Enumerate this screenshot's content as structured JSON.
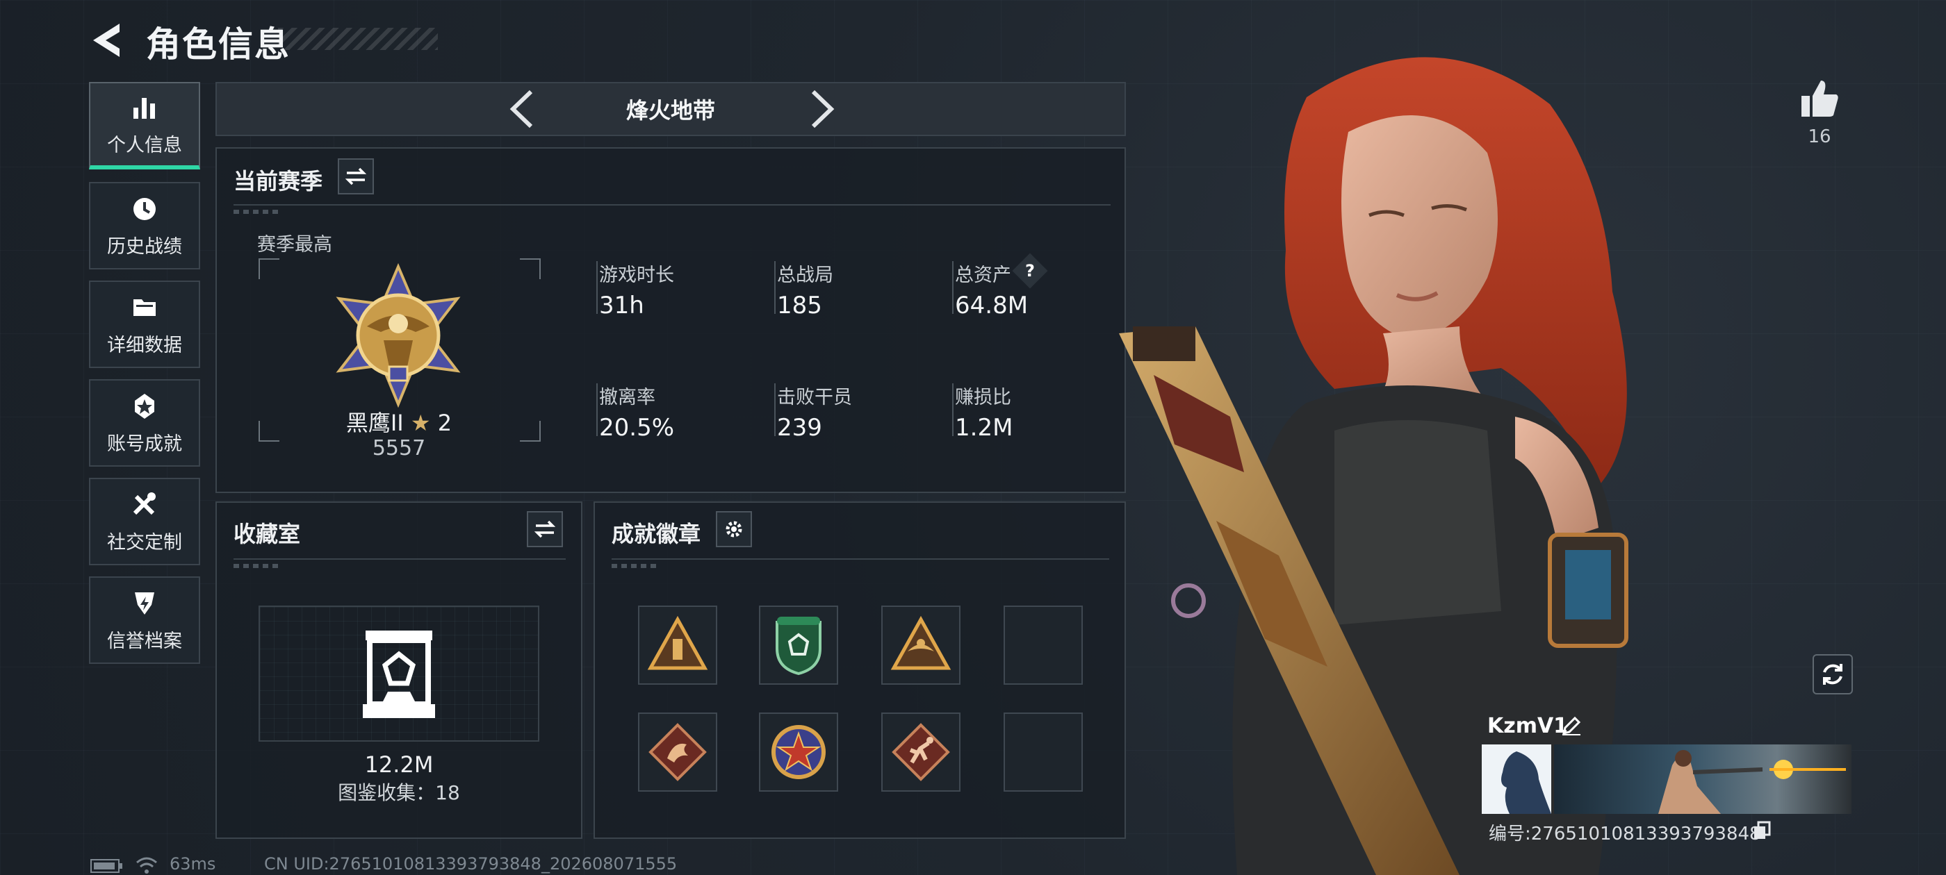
{
  "header": {
    "title": "角色信息"
  },
  "sidebar": {
    "items": [
      {
        "label": "个人信息",
        "icon": "bar-chart-icon",
        "active": true
      },
      {
        "label": "历史战绩",
        "icon": "history-clock-icon"
      },
      {
        "label": "详细数据",
        "icon": "folder-icon"
      },
      {
        "label": "账号成就",
        "icon": "achievement-icon"
      },
      {
        "label": "社交定制",
        "icon": "tools-icon"
      },
      {
        "label": "信誉档案",
        "icon": "credit-shield-icon"
      }
    ]
  },
  "mode_selector": {
    "label": "烽火地带"
  },
  "season": {
    "title": "当前赛季",
    "best_label": "赛季最高",
    "rank_name": "黑鹰II",
    "rank_stars": "2",
    "rank_score": "5557",
    "stats": [
      {
        "label": "游戏时长",
        "value": "31h"
      },
      {
        "label": "总战局",
        "value": "185"
      },
      {
        "label": "总资产",
        "value": "64.8M",
        "help": "?"
      },
      {
        "label": "撤离率",
        "value": "20.5%"
      },
      {
        "label": "击败干员",
        "value": "239"
      },
      {
        "label": "赚损比",
        "value": "1.2M"
      }
    ]
  },
  "collection": {
    "title": "收藏室",
    "value": "12.2M",
    "count_text": "图鉴收集：18"
  },
  "achievements": {
    "title": "成就徽章",
    "badges": [
      "triangle-ammo-badge",
      "green-shield-badge",
      "triangle-eagle-badge",
      "empty",
      "dragon-diamond-badge",
      "star-medal-badge",
      "runner-diamond-badge",
      "empty"
    ]
  },
  "profile": {
    "likes": "16",
    "name": "KzmV1",
    "id_text": "编号:2765101081339379384​8"
  },
  "footer": {
    "ping": "63ms",
    "uid": "CN UID:27651010813393793848_202608071555"
  },
  "colors": {
    "accent": "#2fd7a6",
    "panel_border": "#3b444c",
    "hair": "#b8381f"
  }
}
